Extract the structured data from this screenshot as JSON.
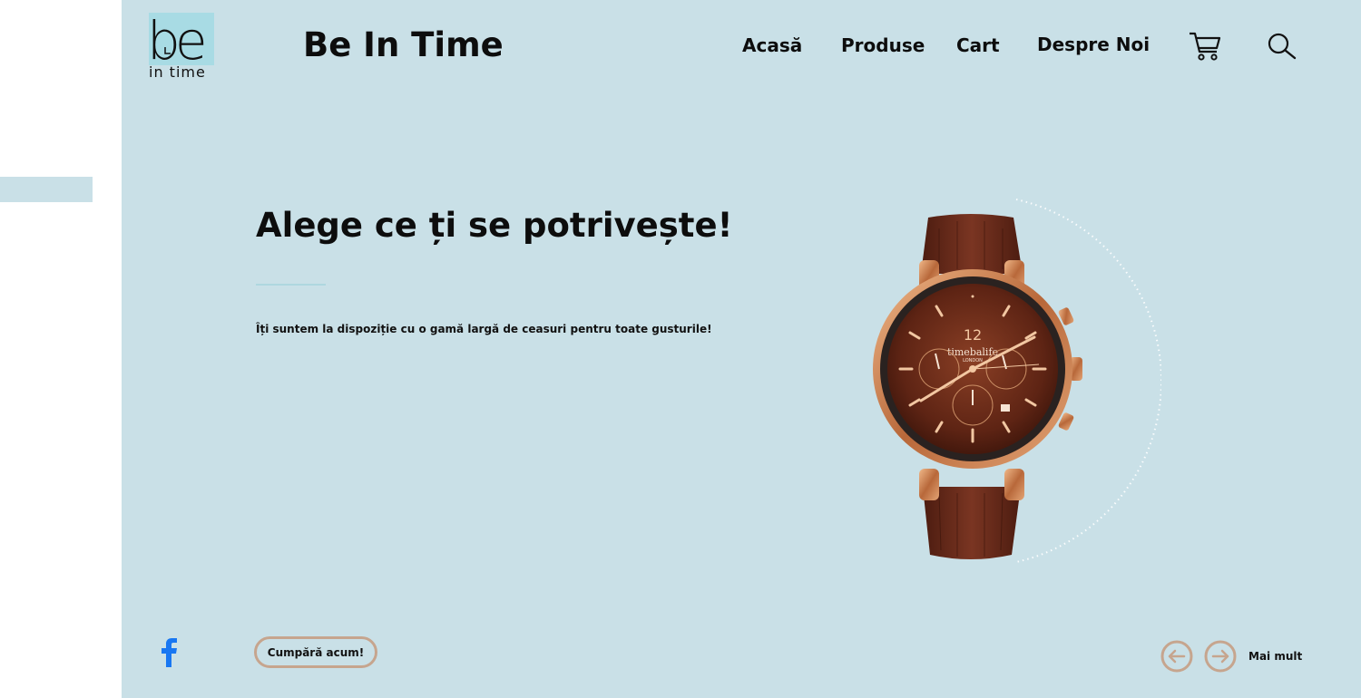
{
  "brand": {
    "logo_text": "be",
    "logo_subtext": "in time",
    "name": "Be In Time"
  },
  "nav": {
    "items": [
      {
        "label": "Acasă"
      },
      {
        "label": "Produse"
      },
      {
        "label": "Cart"
      },
      {
        "label": "Despre Noi"
      }
    ]
  },
  "icons": {
    "cart": "cart-icon",
    "search": "search-icon",
    "facebook": "facebook-icon",
    "prev": "arrow-left-icon",
    "next": "arrow-right-icon"
  },
  "hero": {
    "headline": "Alege ce ți se potrivește!",
    "subtext": "Îți suntem la dispoziție cu o gamă largă de ceasuri pentru toate gusturile!",
    "watch_brand": "timebalife",
    "watch_sub": "LONDON",
    "watch_twelve": "12"
  },
  "actions": {
    "buy_label": "Cumpără acum!",
    "more_label": "Mai mult"
  },
  "colors": {
    "background": "#c9e0e7",
    "accent_border": "#c6a58e",
    "divider": "#aed7df",
    "logo_square": "#a8dbe4",
    "facebook_blue": "#1877f2"
  }
}
